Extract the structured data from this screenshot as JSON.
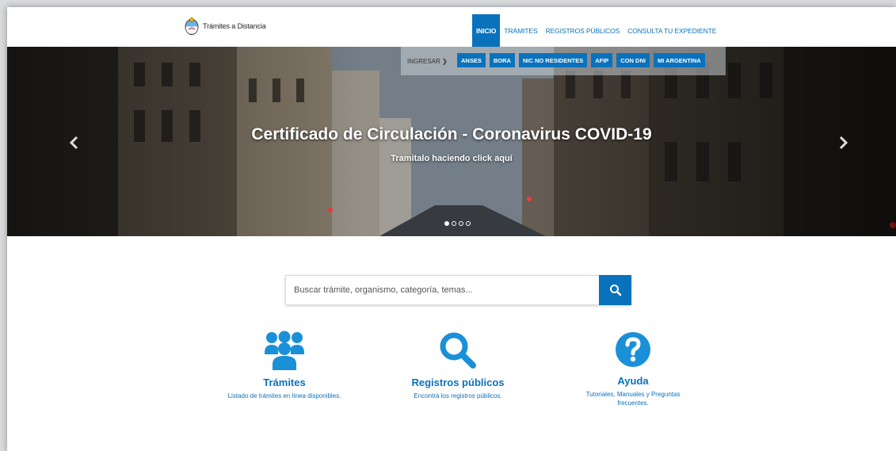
{
  "header": {
    "logo_text": "Trámites a Distancia",
    "nav": [
      {
        "label": "INICIO",
        "active": true
      },
      {
        "label": "TRÁMITES",
        "active": false
      },
      {
        "label": "REGISTROS PÚBLICOS",
        "active": false
      },
      {
        "label": "CONSULTA TU EXPEDIENTE",
        "active": false
      }
    ]
  },
  "hero": {
    "ingresar_label": "INGRESAR ❯",
    "login_buttons": [
      "ANSES",
      "BORA",
      "NIC NO RESIDENTES",
      "AFIP",
      "CON DNI",
      "MI ARGENTINA"
    ],
    "title": "Certificado de Circulación - Coronavirus COVID-19",
    "subtitle": "Tramitalo haciendo click aquí",
    "prev_icon": "chevron-left-icon",
    "next_icon": "chevron-right-icon",
    "slides": 4,
    "active_slide": 1
  },
  "search": {
    "placeholder": "Buscar trámite, organismo, categoría, temas...",
    "icon": "search-icon"
  },
  "features": [
    {
      "title": "Trámites",
      "description": "Listado de trámites en línea disponibles.",
      "icon": "users-icon"
    },
    {
      "title": "Registros públicos",
      "description": "Encontrá los registros públicos.",
      "icon": "magnifier-icon"
    },
    {
      "title": "Ayuda",
      "description": "Tutoriales, Manuales y Preguntas frecuentes.",
      "icon": "question-icon"
    }
  ],
  "colors": {
    "accent": "#0a72bc"
  }
}
